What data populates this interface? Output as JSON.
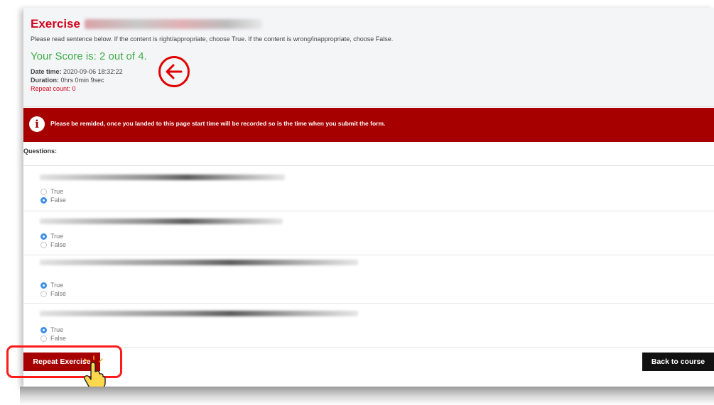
{
  "page": {
    "title_prefix": "Exercise",
    "instruction": "Please read sentence below. If the content is right/appropriate, choose True. If the content is wrong/inappropriate, choose False.",
    "score": "Your Score is: 2 out of 4.",
    "date_time_label": "Date time:",
    "date_time_value": "2020-09-06 18:32:22",
    "duration_label": "Duration:",
    "duration_value": "0hrs 0min 9sec",
    "repeat_count": "Repeat count: 0"
  },
  "notice": {
    "icon": "info-icon",
    "text": "Please be remided, once you landed to this page start time will be recorded so is the time when you submit the form."
  },
  "questions": {
    "label": "Questions:",
    "items": [
      {
        "true_label": "True",
        "false_label": "False",
        "selected": "False"
      },
      {
        "true_label": "True",
        "false_label": "False",
        "selected": "True"
      },
      {
        "true_label": "True",
        "false_label": "False",
        "selected": "True"
      },
      {
        "true_label": "True",
        "false_label": "False",
        "selected": "True"
      }
    ]
  },
  "actions": {
    "repeat_label": "Repeat Exercise",
    "back_label": "Back to course"
  },
  "colors": {
    "accent_red": "#a70000",
    "title_red": "#d0021b",
    "score_green": "#3fae49",
    "radio_blue": "#3b8ee8",
    "annotation_red": "#ff1a1a"
  },
  "annotations": {
    "arrow_icon": "left-arrow-circle-icon",
    "pointer_icon": "pointing-hand-icon"
  }
}
